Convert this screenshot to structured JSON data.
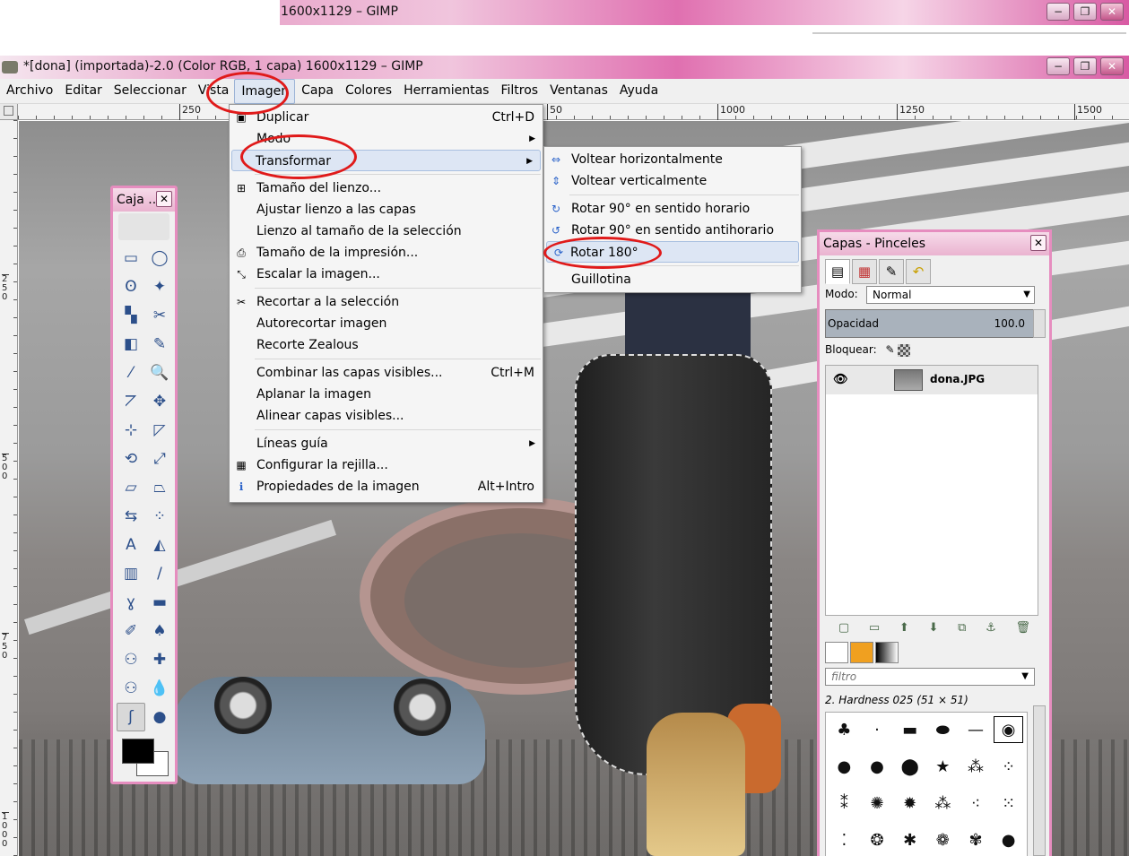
{
  "windows": {
    "back_title": "1600x1129 – GIMP",
    "front_title": "*[dona] (importada)-2.0 (Color RGB, 1 capa) 1600x1129 – GIMP",
    "min": "−",
    "max": "❐",
    "close": "✕"
  },
  "menubar": [
    "Archivo",
    "Editar",
    "Seleccionar",
    "Vista",
    "Imagen",
    "Capa",
    "Colores",
    "Herramientas",
    "Filtros",
    "Ventanas",
    "Ayuda"
  ],
  "ruler": {
    "top_ticks": [
      "250",
      "50",
      "1000",
      "1250",
      "1500"
    ],
    "left_ticks": [
      "250",
      "500",
      "750",
      "1000"
    ]
  },
  "image_menu": {
    "items": [
      {
        "label": "Duplicar",
        "shortcut": "Ctrl+D",
        "icon": "▣"
      },
      {
        "label": "Modo",
        "submenu": true
      },
      {
        "label": "Transformar",
        "submenu": true,
        "highlighted": true
      },
      {
        "sep": true
      },
      {
        "label": "Tamaño del lienzo...",
        "icon": "⊞"
      },
      {
        "label": "Ajustar lienzo a las capas"
      },
      {
        "label": "Lienzo al tamaño de la selección"
      },
      {
        "label": "Tamaño de la impresión...",
        "icon": "⎙"
      },
      {
        "label": "Escalar la imagen...",
        "icon": "⤡"
      },
      {
        "sep": true
      },
      {
        "label": "Recortar a la selección",
        "icon": "✂"
      },
      {
        "label": "Autorecortar imagen"
      },
      {
        "label": "Recorte Zealous"
      },
      {
        "sep": true
      },
      {
        "label": "Combinar las capas visibles...",
        "shortcut": "Ctrl+M"
      },
      {
        "label": "Aplanar la imagen"
      },
      {
        "label": "Alinear capas visibles..."
      },
      {
        "sep": true
      },
      {
        "label": "Líneas guía",
        "submenu": true
      },
      {
        "label": "Configurar la rejilla...",
        "icon": "▦"
      },
      {
        "label": "Propiedades de la imagen",
        "shortcut": "Alt+Intro",
        "icon": "ℹ"
      }
    ]
  },
  "transform_menu": {
    "items": [
      {
        "label": "Voltear horizontalmente",
        "icon": "⇔"
      },
      {
        "label": "Voltear verticalmente",
        "icon": "⇕"
      },
      {
        "sep": true
      },
      {
        "label": "Rotar 90° en sentido horario",
        "icon": "↻"
      },
      {
        "label": "Rotar 90° en sentido antihorario",
        "icon": "↺"
      },
      {
        "label": "Rotar 180°",
        "icon": "⟳",
        "highlighted": true
      },
      {
        "sep": true
      },
      {
        "label": "Guillotina"
      }
    ]
  },
  "toolbox": {
    "title": "Caja ...",
    "close": "✕",
    "tools": [
      "rect-select-icon",
      "ellipse-select-icon",
      "lasso-icon",
      "fuzzy-select-icon",
      "color-select-icon",
      "scissors-icon",
      "foreground-select-icon",
      "paths-icon",
      "color-picker-icon",
      "zoom-icon",
      "measure-icon",
      "move-icon",
      "align-icon",
      "crop-icon",
      "rotate-icon",
      "scale-icon",
      "shear-icon",
      "perspective-icon",
      "flip-icon",
      "cage-icon",
      "text-icon",
      "bucket-fill-icon",
      "blend-icon",
      "pencil-icon",
      "paintbrush-icon",
      "eraser-icon",
      "airbrush-icon",
      "ink-icon",
      "clone-icon",
      "heal-icon",
      "perspective-clone-icon",
      "blur-icon",
      "smudge-icon",
      "dodge-burn-icon"
    ],
    "glyphs": [
      "▭",
      "◯",
      "ʘ",
      "✦",
      "▚",
      "✂",
      "◧",
      "✎",
      "⁄",
      "🔍",
      "⦢",
      "✥",
      "⊹",
      "◸",
      "⟲",
      "⤢",
      "▱",
      "⏢",
      "⇆",
      "⁘",
      "A",
      "◭",
      "▥",
      "/",
      "ɣ",
      "▬",
      "✐",
      "♠",
      "⚇",
      "✚",
      "⚇",
      "💧",
      "ʃ",
      "●"
    ]
  },
  "dock": {
    "title": "Capas - Pinceles",
    "close": "✕",
    "mode_label": "Modo:",
    "mode_value": "Normal",
    "opacity_label": "Opacidad",
    "opacity_value": "100.0",
    "lock_label": "Bloquear:",
    "layer_name": "dona.JPG",
    "filter_placeholder": "filtro",
    "brush_name": "2. Hardness 025 (51 × 51)"
  }
}
